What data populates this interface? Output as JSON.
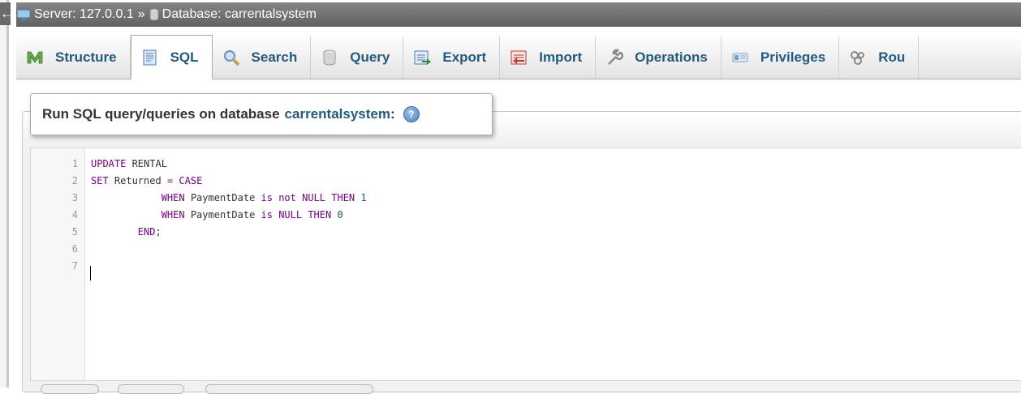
{
  "nav": {
    "back_glyph": "←",
    "server_label": "Server: 127.0.0.1",
    "separator": "»",
    "database_label": "Database: carrentalsystem"
  },
  "tabs": [
    {
      "label": "Structure",
      "icon": "structure-icon",
      "active": false
    },
    {
      "label": "SQL",
      "icon": "sql-icon",
      "active": true
    },
    {
      "label": "Search",
      "icon": "search-icon",
      "active": false
    },
    {
      "label": "Query",
      "icon": "query-icon",
      "active": false
    },
    {
      "label": "Export",
      "icon": "export-icon",
      "active": false
    },
    {
      "label": "Import",
      "icon": "import-icon",
      "active": false
    },
    {
      "label": "Operations",
      "icon": "wrench-icon",
      "active": false
    },
    {
      "label": "Privileges",
      "icon": "privileges-icon",
      "active": false
    },
    {
      "label": "Rou",
      "icon": "routines-icon",
      "active": false
    }
  ],
  "panel": {
    "title": "Run SQL query/queries on database",
    "database": "carrentalsystem",
    "colon": ":",
    "help_glyph": "?"
  },
  "editor": {
    "line_numbers": [
      "1",
      "2",
      "3",
      "4",
      "5",
      "6",
      "7"
    ],
    "lines": [
      [
        {
          "t": "UPDATE",
          "c": "kw"
        },
        {
          "t": " RENTAL",
          "c": ""
        }
      ],
      [
        {
          "t": "SET",
          "c": "kw"
        },
        {
          "t": " Returned ",
          "c": ""
        },
        {
          "t": "=",
          "c": "op"
        },
        {
          "t": " ",
          "c": ""
        },
        {
          "t": "CASE",
          "c": "kw"
        }
      ],
      [
        {
          "t": "            ",
          "c": ""
        },
        {
          "t": "WHEN",
          "c": "kw"
        },
        {
          "t": " PaymentDate ",
          "c": ""
        },
        {
          "t": "is not NULL THEN",
          "c": "kw"
        },
        {
          "t": " ",
          "c": ""
        },
        {
          "t": "1",
          "c": "num"
        }
      ],
      [
        {
          "t": "            ",
          "c": ""
        },
        {
          "t": "WHEN",
          "c": "kw"
        },
        {
          "t": " PaymentDate ",
          "c": ""
        },
        {
          "t": "is NULL THEN",
          "c": "kw"
        },
        {
          "t": " ",
          "c": ""
        },
        {
          "t": "0",
          "c": "num"
        }
      ],
      [
        {
          "t": "        ",
          "c": ""
        },
        {
          "t": "END",
          "c": "kw"
        },
        {
          "t": ";",
          "c": ""
        }
      ],
      [],
      []
    ]
  },
  "colors": {
    "link_blue": "#235a81",
    "keyword": "#770088",
    "number": "#116644",
    "operator": "#981a1a"
  }
}
